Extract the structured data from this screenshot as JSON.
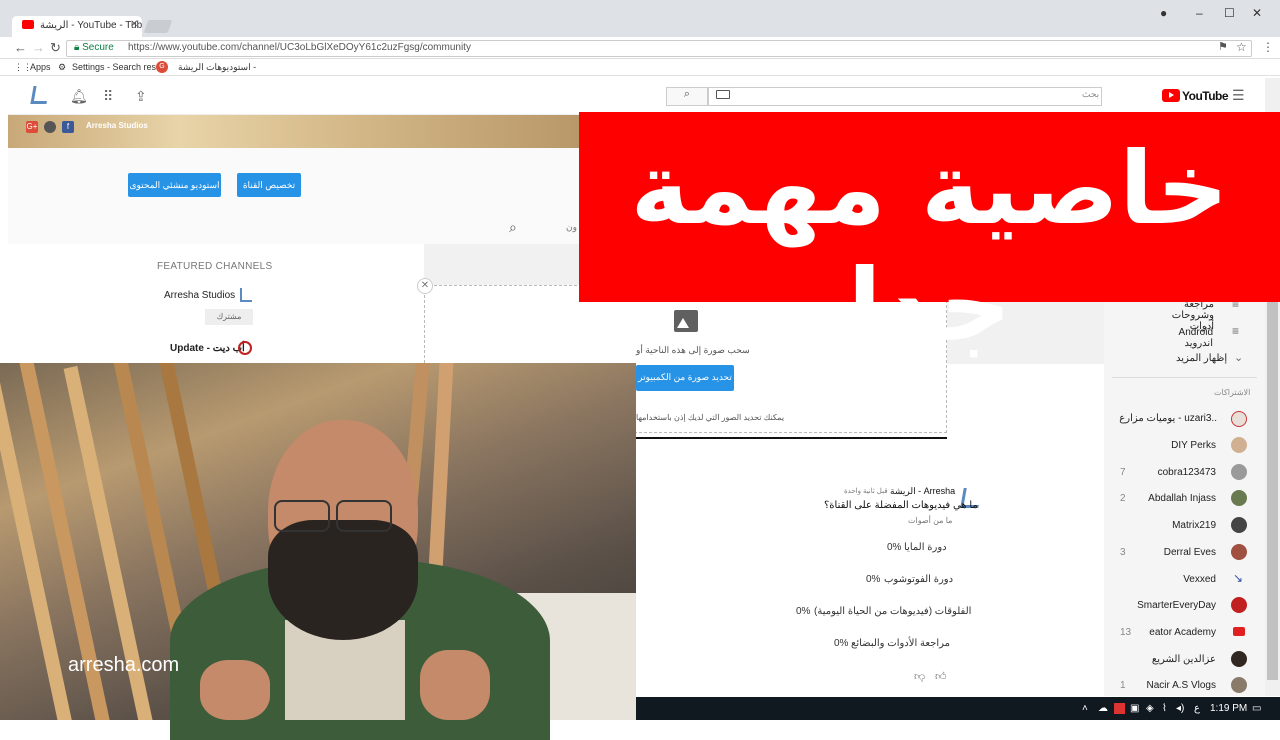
{
  "browser": {
    "tab_title": "الريشة - YouTube - Tube",
    "secure_label": "Secure",
    "url": "https://www.youtube.com/channel/UC3oLbGlXeDOyY61c2uzFgsg/community",
    "bookmarks": [
      "Apps",
      "Settings - Search res",
      "استوديوهات الريشة -"
    ]
  },
  "youtube": {
    "logo_text": "YouTube",
    "search_placeholder": "بحث"
  },
  "banner": {
    "channel_label": "Arresha Studios"
  },
  "channel": {
    "customize_button": "تخصيص القناة",
    "studio_button": "استوديو منشئي المحتوى",
    "partial_text": "ون",
    "featured_title": "FEATURED CHANNELS",
    "featured": [
      {
        "name": "Arresha Studios",
        "sub_label": "مشترك"
      },
      {
        "name": "Update - أب ديت"
      }
    ]
  },
  "dropzone": {
    "drag_text": "سحب صورة إلى هذه الناحية أو",
    "select_button": "تحديد صورة من الكمبيوتر",
    "hint": "يمكنك تحديد الصور التي لديك إذن باستخدامها"
  },
  "post": {
    "author": "الريشة - Arresha",
    "time": "قبل ثانية واحدة",
    "question": "ما هي فيديوهات المفضلة على القناة؟",
    "votes": "ما من أصوات",
    "options": [
      {
        "label": "دورة المايا",
        "pct": "0%"
      },
      {
        "label": "دورة الفوتوشوب",
        "pct": "0%"
      },
      {
        "label": "الفلوقات (فيديوهات من الحياة اليومية)",
        "pct": "0%"
      },
      {
        "label": "مراجعة الأدوات والبضائع",
        "pct": "0%"
      }
    ]
  },
  "sidebar": {
    "items": [
      {
        "label": "مراجعة وشروحات أدوات"
      },
      {
        "label": "Android اندرويد"
      },
      {
        "label": "إظهار المزيد"
      }
    ],
    "subs_heading": "الاشتراكات",
    "subs": [
      {
        "name": "يوميات مزارع - uzari3..",
        "count": "",
        "color": "#e8e0d8"
      },
      {
        "name": "DIY Perks",
        "count": "",
        "color": "#d0b090"
      },
      {
        "name": "cobra123473",
        "count": "7",
        "color": "#9a9a9a"
      },
      {
        "name": "Abdallah Injass",
        "count": "2",
        "color": "#6a7a50"
      },
      {
        "name": "Matrix219",
        "count": "",
        "color": "#444"
      },
      {
        "name": "Derral Eves",
        "count": "3",
        "color": "#a05040"
      },
      {
        "name": "Vexxed",
        "count": "",
        "color": "#3050a0"
      },
      {
        "name": "SmarterEveryDay",
        "count": "",
        "color": "#c02020"
      },
      {
        "name": "eator Academy",
        "count": "13",
        "color": "#e02020"
      },
      {
        "name": "عزالدين الشريع",
        "count": "",
        "color": "#302820"
      },
      {
        "name": "Nacir A.S Vlogs",
        "count": "1",
        "color": "#8a7a6a"
      }
    ]
  },
  "overlay": {
    "headline": "خاصية مهمة جدا"
  },
  "webcam": {
    "watermark": "arresha.com"
  },
  "taskbar": {
    "lang": "ع",
    "time": "1:19 PM"
  },
  "colors": {
    "overlay_red": "#ff0000",
    "youtube_red": "#ff0000",
    "button_blue": "#2793e6"
  }
}
